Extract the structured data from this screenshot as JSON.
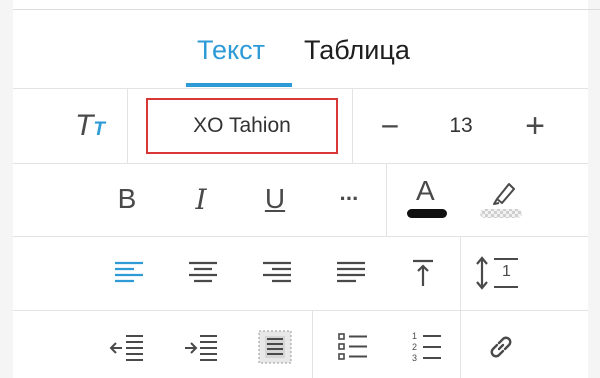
{
  "tabs": [
    {
      "label": "Текст",
      "active": true
    },
    {
      "label": "Таблица",
      "active": false
    }
  ],
  "font": {
    "size_icon_big": "T",
    "size_icon_small": "T",
    "name": "XO Tahion",
    "size": "13",
    "decrease_label": "−",
    "increase_label": "+"
  },
  "format": {
    "bold": "B",
    "italic": "I",
    "underline": "U",
    "more": "···",
    "text_color_letter": "A",
    "text_color_value": "#111111"
  },
  "spacing_icon_label": "1",
  "numbered_list_digits": [
    "1",
    "2",
    "3"
  ],
  "colors": {
    "accent": "#2e9ad6",
    "highlight_border": "#d93636",
    "icon": "#4a4a4a"
  },
  "icons": {
    "font_size": "font-size-icon",
    "bold": "bold-icon",
    "italic": "italic-icon",
    "underline": "underline-icon",
    "more": "more-icon",
    "text_color": "text-color-icon",
    "highlight": "highlighter-icon",
    "align_left": "align-left-icon",
    "align_center": "align-center-icon",
    "align_right": "align-right-icon",
    "align_justify": "align-justify-icon",
    "vertical_top": "vertical-align-top-icon",
    "line_spacing": "line-spacing-icon",
    "outdent": "outdent-icon",
    "indent": "indent-icon",
    "text_wrap": "text-wrap-icon",
    "bullet_list": "bulleted-list-icon",
    "numbered_list": "numbered-list-icon",
    "link": "link-icon"
  },
  "states": {
    "active_alignment": "left"
  }
}
